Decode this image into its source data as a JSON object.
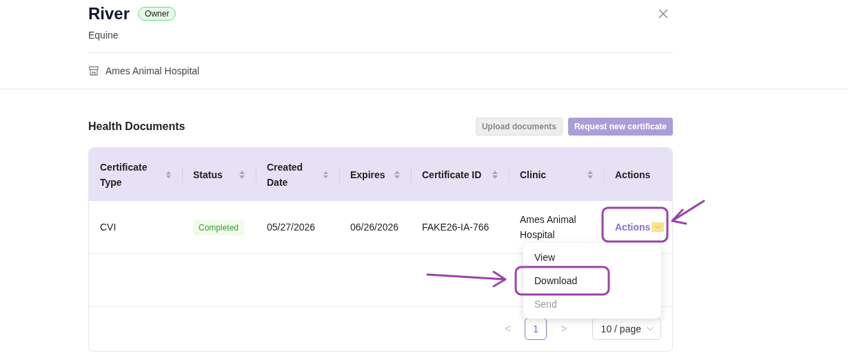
{
  "pet": {
    "name": "River",
    "role_badge": "Owner",
    "species": "Equine",
    "clinic": "Ames Animal Hospital"
  },
  "section": {
    "title": "Health Documents",
    "buttons": [
      {
        "label": "Upload documents",
        "kind": "secondary",
        "disabled": true
      },
      {
        "label": "Request new certificate",
        "kind": "primary",
        "disabled": true
      }
    ]
  },
  "table": {
    "columns": [
      {
        "label": "Certificate Type",
        "sortable": true
      },
      {
        "label": "Status",
        "sortable": true
      },
      {
        "label": "Created Date",
        "sortable": true
      },
      {
        "label": "Expires",
        "sortable": true
      },
      {
        "label": "Certificate ID",
        "sortable": true
      },
      {
        "label": "Clinic",
        "sortable": true
      },
      {
        "label": "Actions",
        "sortable": false
      }
    ],
    "rows": [
      {
        "type": "CVI",
        "status": "Completed",
        "created": "05/27/2026",
        "expires": "06/26/2026",
        "certificate_id": "FAKE26-IA-766",
        "clinic": "Ames Animal Hospital",
        "action": "Actions"
      }
    ]
  },
  "actions_menu": {
    "items": [
      {
        "label": "View",
        "disabled": false
      },
      {
        "label": "Download",
        "disabled": false
      },
      {
        "label": "Send",
        "disabled": true
      }
    ]
  },
  "pagination": {
    "prev": "<",
    "pages": [
      {
        "label": "1",
        "selected": true
      }
    ],
    "next": ">",
    "page_size": "10 / page"
  }
}
